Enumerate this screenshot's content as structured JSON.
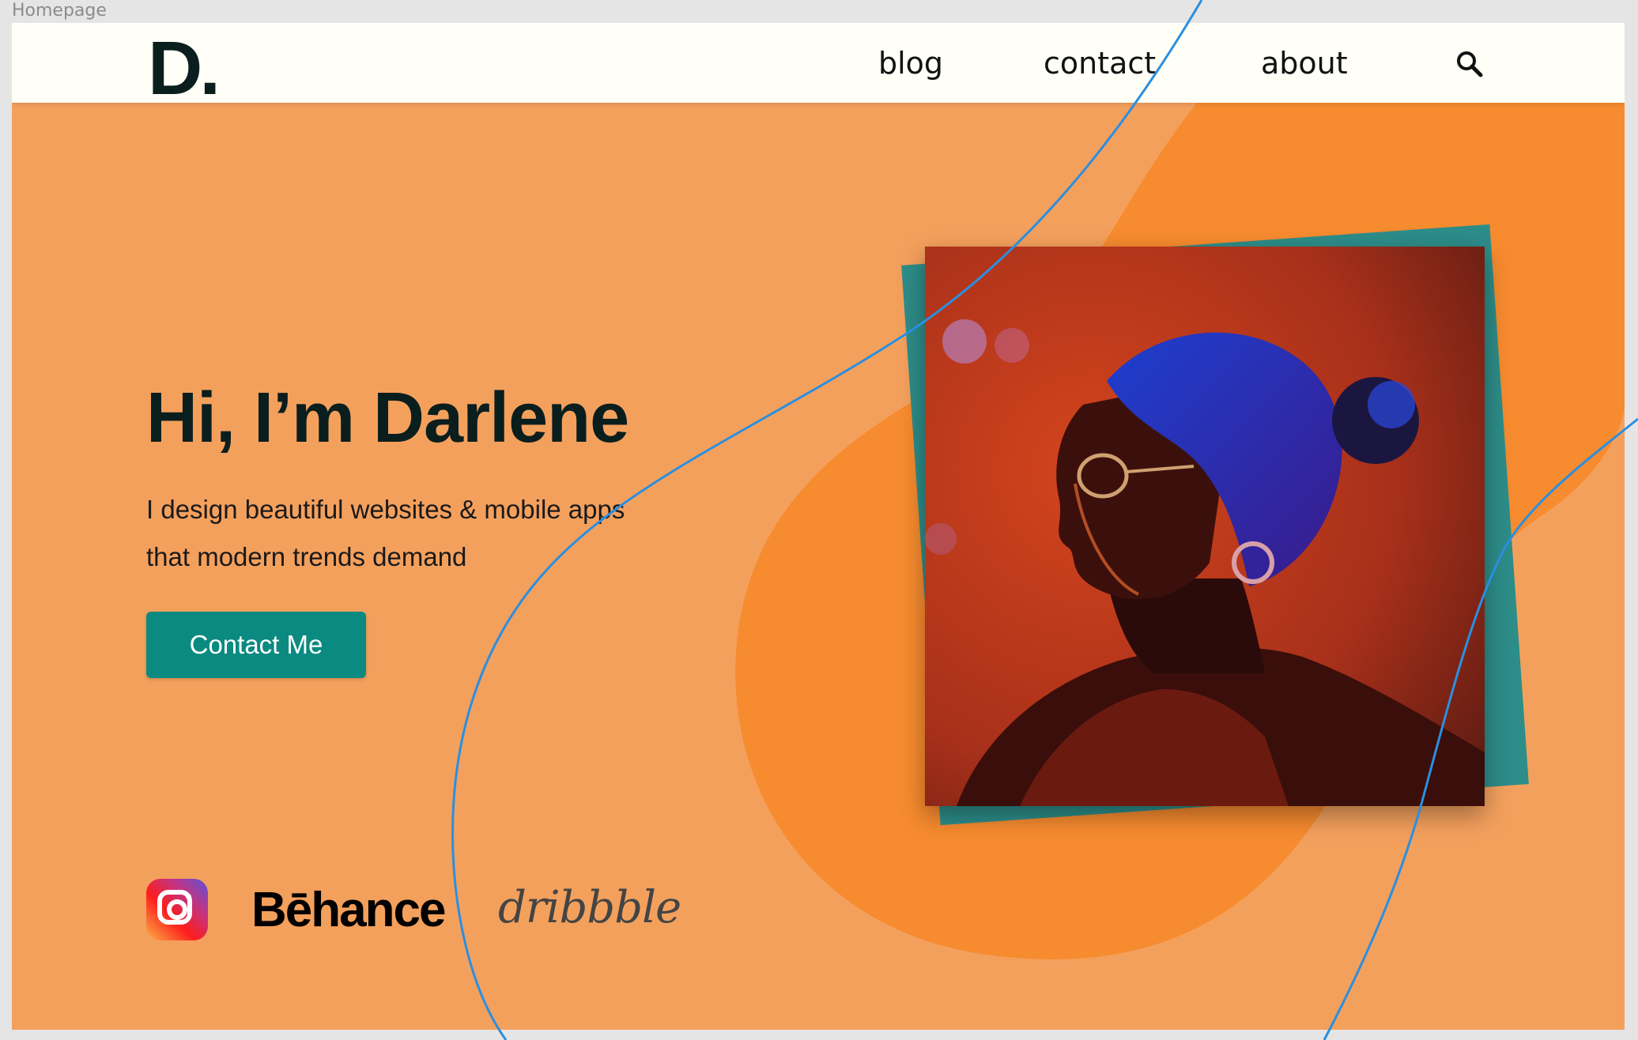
{
  "frame": {
    "label": "Homepage"
  },
  "nav": {
    "logo": "D.",
    "links": [
      {
        "label": "blog"
      },
      {
        "label": "contact"
      },
      {
        "label": "about"
      }
    ],
    "search_icon": "search-icon"
  },
  "hero": {
    "title": "Hi, I’m Darlene",
    "subtitle": "I design beautiful websites & mobile apps that modern trends demand",
    "cta_label": "Contact Me"
  },
  "social": {
    "instagram_icon": "instagram-icon",
    "behance": "Bēhance",
    "dribbble": "dribbble"
  },
  "colors": {
    "background": "#f4a05d",
    "blob": "#f78b2f",
    "accent": "#0a8a80",
    "photo_back": "#2d8d89",
    "nav_bg": "#fffff8",
    "text_dark": "#0b1e1e",
    "curve": "#2a8fe0"
  }
}
